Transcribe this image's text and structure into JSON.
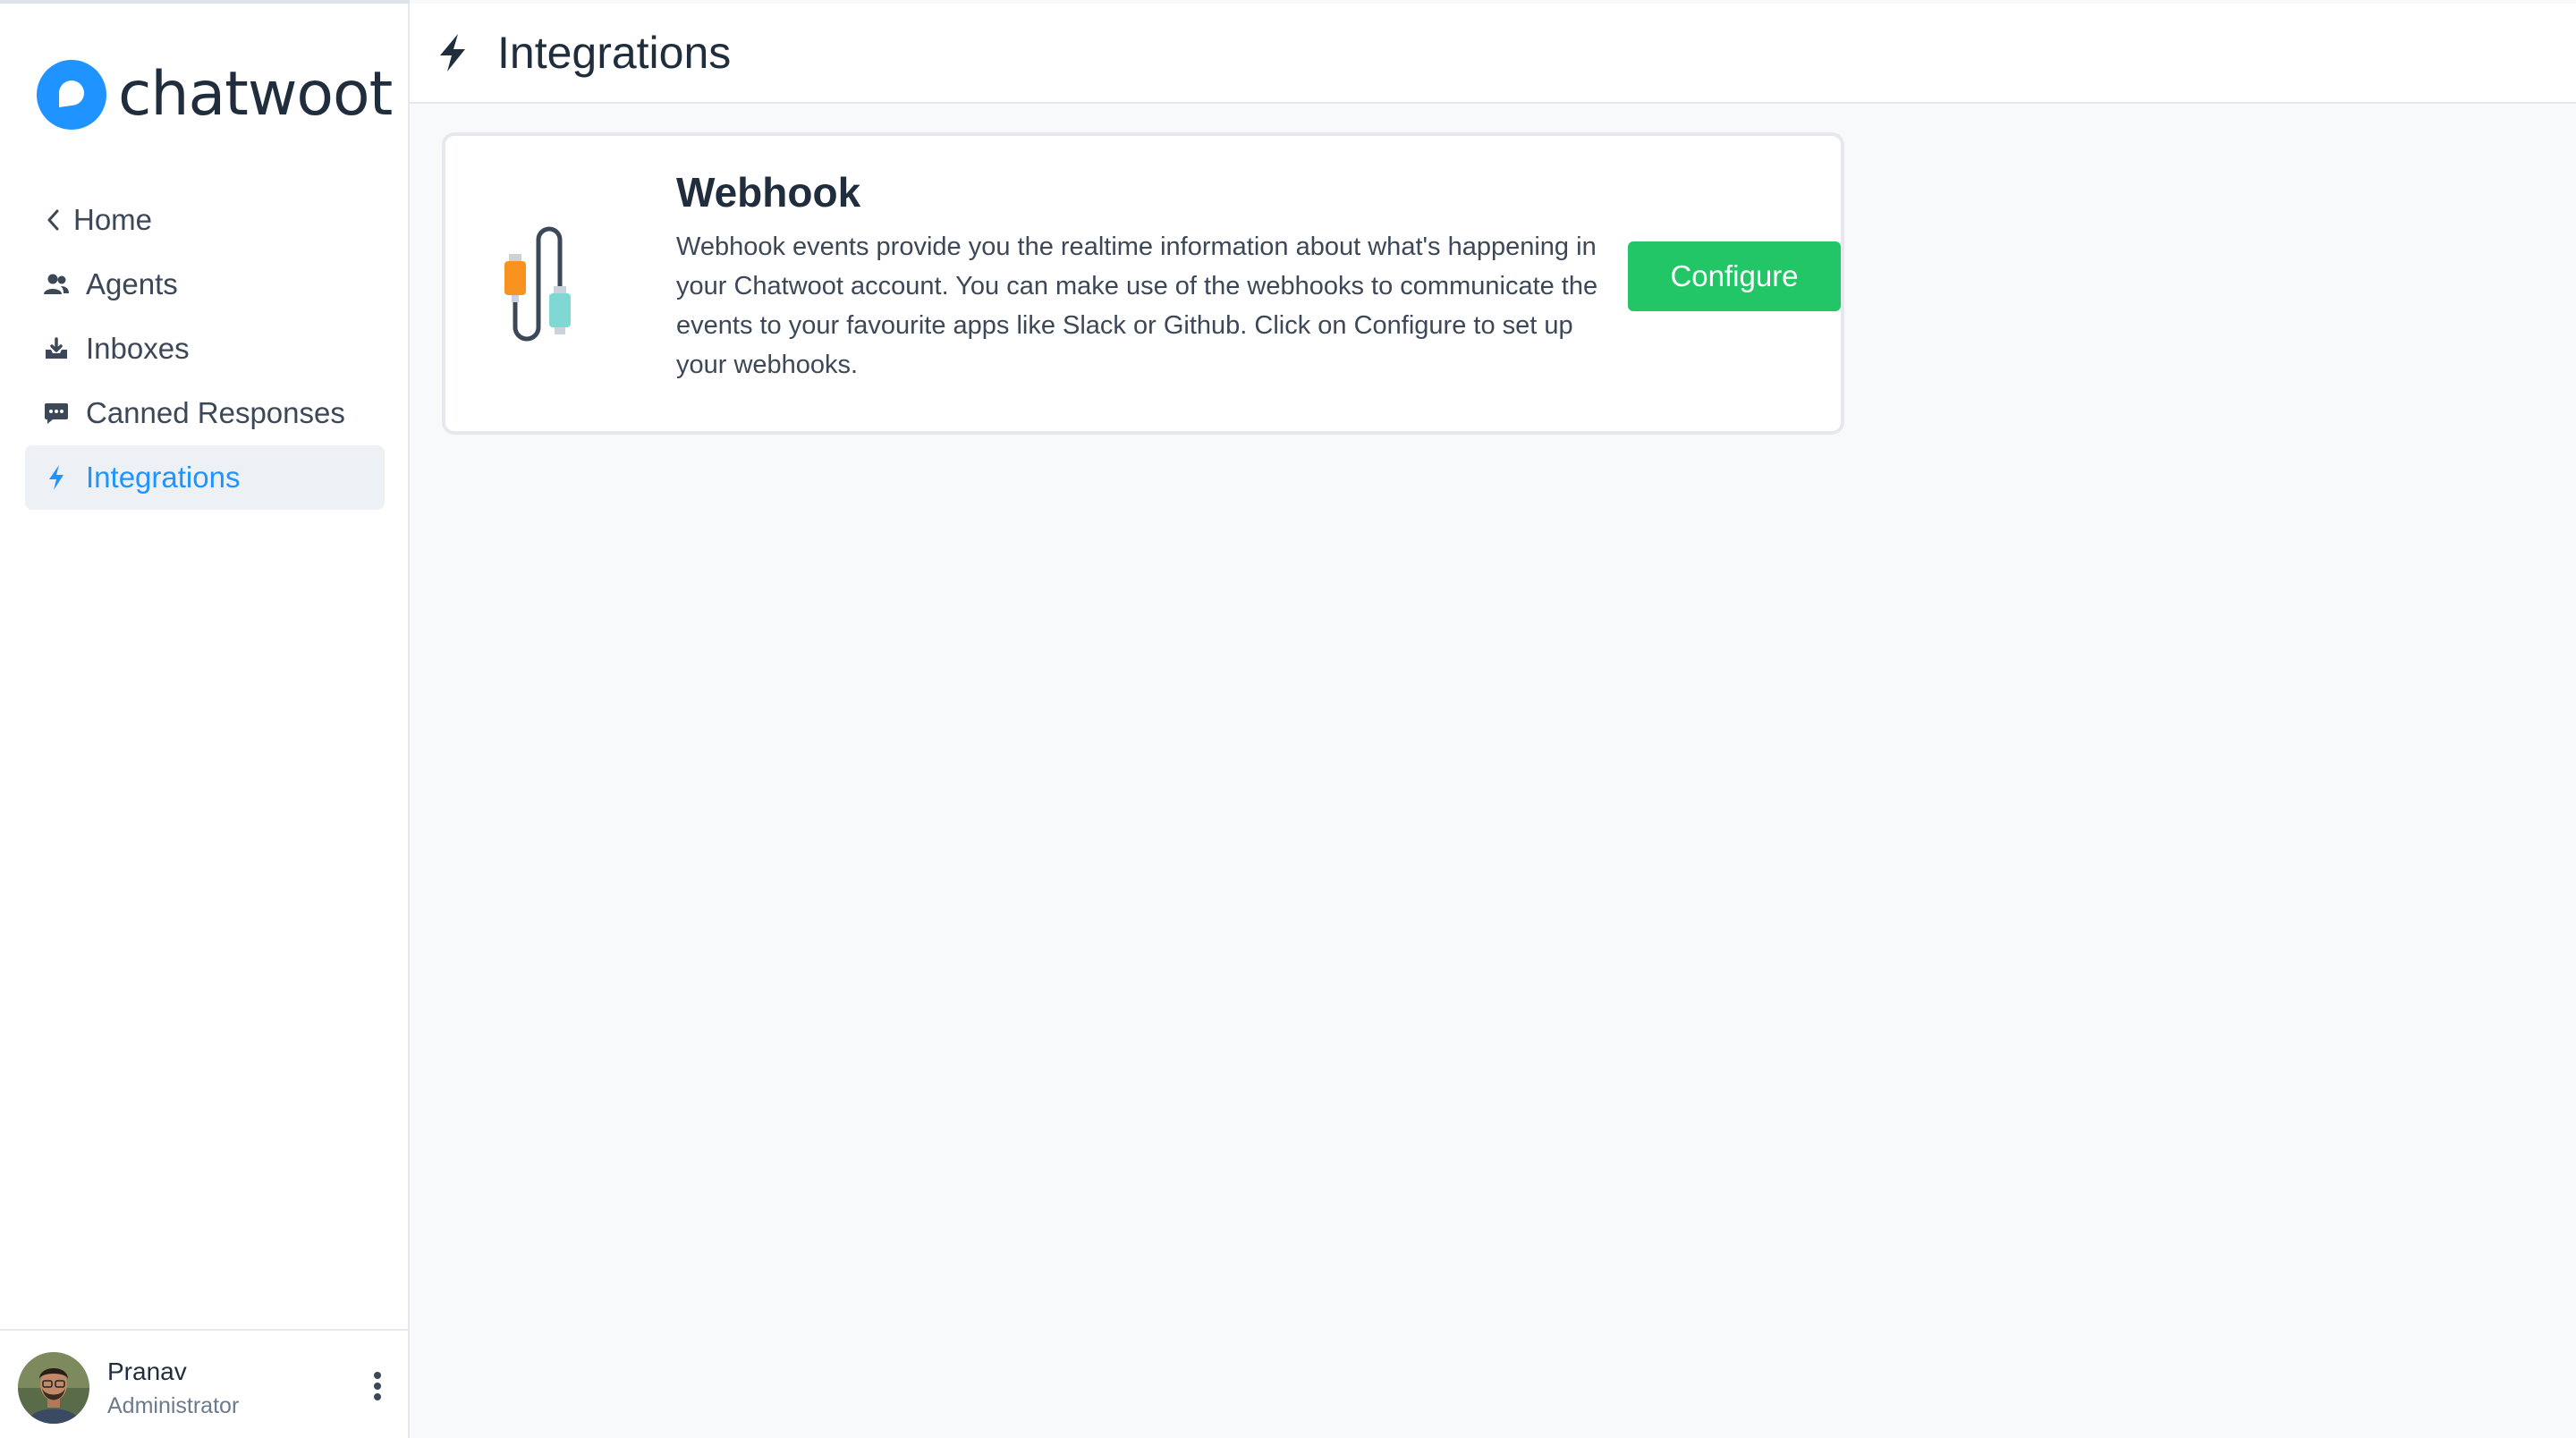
{
  "brand": {
    "name": "chatwoot",
    "accent_color": "#1f93ff",
    "success_color": "#22c667"
  },
  "sidebar": {
    "items": [
      {
        "label": "Home",
        "icon": "chevron-left-icon"
      },
      {
        "label": "Agents",
        "icon": "people-icon"
      },
      {
        "label": "Inboxes",
        "icon": "inbox-download-icon"
      },
      {
        "label": "Canned Responses",
        "icon": "chat-bubble-icon"
      },
      {
        "label": "Integrations",
        "icon": "lightning-icon",
        "active": true
      }
    ]
  },
  "user": {
    "name": "Pranav",
    "role": "Administrator"
  },
  "header": {
    "title": "Integrations",
    "icon": "lightning-icon"
  },
  "integration_card": {
    "title": "Webhook",
    "description": "Webhook events provide you the realtime information about what's happening in your Chatwoot account. You can make use of the webhooks to communicate the events to your favourite apps like Slack or Github. Click on Configure to set up your webhooks.",
    "button_label": "Configure",
    "illustration": "cable-plug-icon"
  }
}
